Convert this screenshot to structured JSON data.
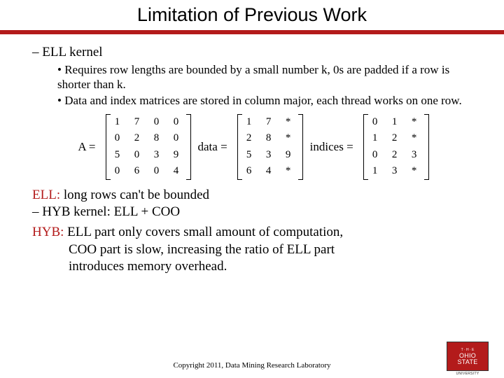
{
  "title": "Limitation of Previous Work",
  "section1_heading": "ELL kernel",
  "bullets": [
    "Requires row lengths are bounded by a small number k, 0s are padded if a row is shorter than k.",
    "Data and index matrices are stored in column major, each thread works on one row."
  ],
  "matrix": {
    "A_label": "A =",
    "A": [
      [
        "1",
        "7",
        "0",
        "0"
      ],
      [
        "0",
        "2",
        "8",
        "0"
      ],
      [
        "5",
        "0",
        "3",
        "9"
      ],
      [
        "0",
        "6",
        "0",
        "4"
      ]
    ],
    "data_label": "data =",
    "data": [
      [
        "1",
        "7",
        "*"
      ],
      [
        "2",
        "8",
        "*"
      ],
      [
        "5",
        "3",
        "9"
      ],
      [
        "6",
        "4",
        "*"
      ]
    ],
    "indices_label": "indices =",
    "indices": [
      [
        "0",
        "1",
        "*"
      ],
      [
        "1",
        "2",
        "*"
      ],
      [
        "0",
        "2",
        "3"
      ],
      [
        "1",
        "3",
        "*"
      ]
    ]
  },
  "ell_label": "ELL:",
  "ell_stmt": " long rows can't be bounded",
  "hyb_item": "HYB kernel: ELL + COO",
  "hyb_label": "HYB:",
  "hyb_stmt1": " ELL part only covers small amount of computation,",
  "hyb_stmt2": "COO part is slow, increasing the ratio of ELL part",
  "hyb_stmt3": "introduces memory overhead.",
  "footer": "Copyright 2011, Data Mining Research Laboratory",
  "logo": {
    "the": "T · H · E",
    "line1": "OHIO",
    "line2": "STATE",
    "univ": "UNIVERSITY"
  }
}
